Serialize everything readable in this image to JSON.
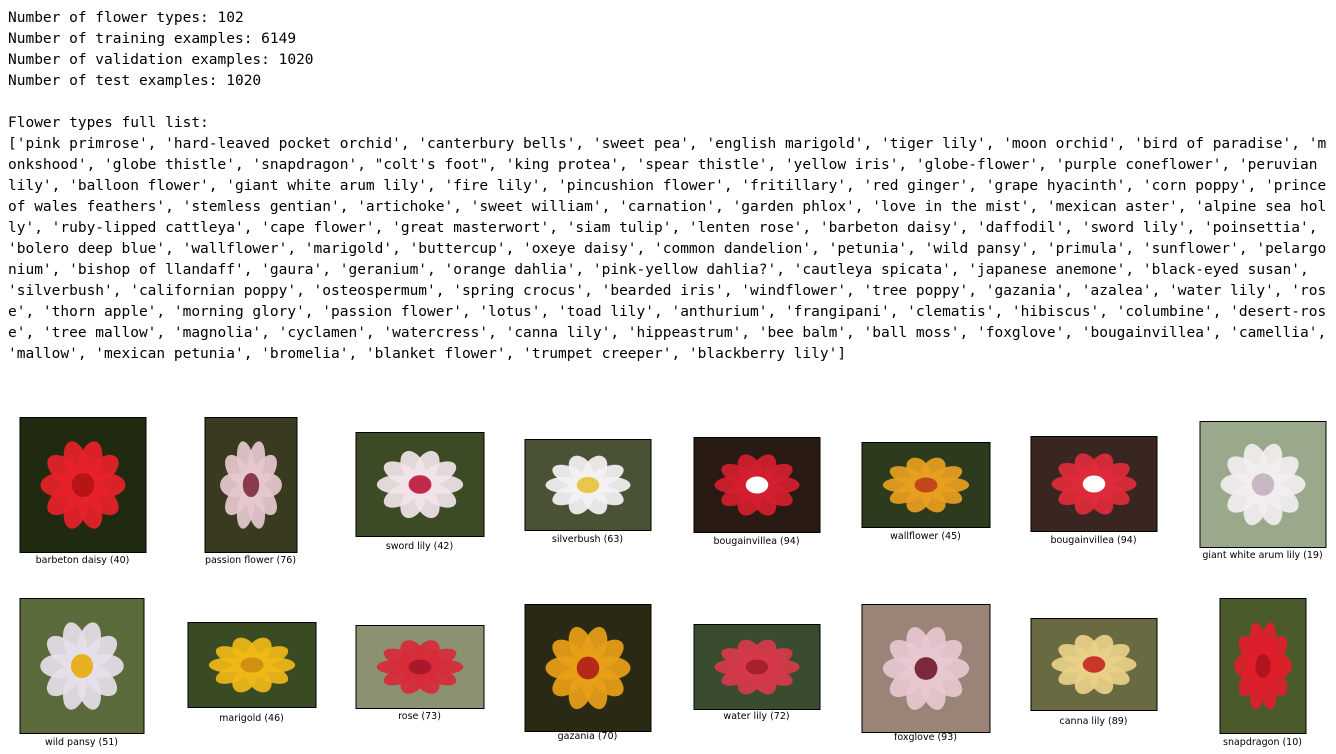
{
  "output": {
    "stats": [
      "Number of flower types: 102",
      "Number of training examples: 6149",
      "Number of validation examples: 1020",
      "Number of test examples: 1020"
    ],
    "list_heading": "Flower types full list:",
    "list_text": "['pink primrose', 'hard-leaved pocket orchid', 'canterbury bells', 'sweet pea', 'english marigold', 'tiger lily', 'moon orchid', 'bird of paradise', 'monkshood', 'globe thistle', 'snapdragon', \"colt's foot\", 'king protea', 'spear thistle', 'yellow iris', 'globe-flower', 'purple coneflower', 'peruvian lily', 'balloon flower', 'giant white arum lily', 'fire lily', 'pincushion flower', 'fritillary', 'red ginger', 'grape hyacinth', 'corn poppy', 'prince of wales feathers', 'stemless gentian', 'artichoke', 'sweet william', 'carnation', 'garden phlox', 'love in the mist', 'mexican aster', 'alpine sea holly', 'ruby-lipped cattleya', 'cape flower', 'great masterwort', 'siam tulip', 'lenten rose', 'barbeton daisy', 'daffodil', 'sword lily', 'poinsettia', 'bolero deep blue', 'wallflower', 'marigold', 'buttercup', 'oxeye daisy', 'common dandelion', 'petunia', 'wild pansy', 'primula', 'sunflower', 'pelargonium', 'bishop of llandaff', 'gaura', 'geranium', 'orange dahlia', 'pink-yellow dahlia?', 'cautleya spicata', 'japanese anemone', 'black-eyed susan', 'silverbush', 'californian poppy', 'osteospermum', 'spring crocus', 'bearded iris', 'windflower', 'tree poppy', 'gazania', 'azalea', 'water lily', 'rose', 'thorn apple', 'morning glory', 'passion flower', 'lotus', 'toad lily', 'anthurium', 'frangipani', 'clematis', 'hibiscus', 'columbine', 'desert-rose', 'tree mallow', 'magnolia', 'cyclamen', 'watercress', 'canna lily', 'hippeastrum', 'bee balm', 'ball moss', 'foxglove', 'bougainvillea', 'camellia', 'mallow', 'mexican petunia', 'bromelia', 'blanket flower', 'trumpet creeper', 'blackberry lily']"
  },
  "gallery": [
    {
      "caption": "barbeton daisy (40)",
      "icon": "red-daisy-photo",
      "bg": "#1f2a10",
      "petal": "#e8222a",
      "center": "#b81418"
    },
    {
      "caption": "passion flower (76)",
      "icon": "passion-flower-photo",
      "bg": "#3a3a20",
      "petal": "#e6c9cf",
      "center": "#8a3a4a"
    },
    {
      "caption": "sword lily (42)",
      "icon": "sword-lily-photo",
      "bg": "#3c4a26",
      "petal": "#f2e4e8",
      "center": "#c22a4a"
    },
    {
      "caption": "silverbush (63)",
      "icon": "silverbush-photo",
      "bg": "#4a5236",
      "petal": "#f4f2f4",
      "center": "#e8c84a"
    },
    {
      "caption": "bougainvillea (94)",
      "icon": "bougainvillea-photo",
      "bg": "#2a1a14",
      "petal": "#d41e2e",
      "center": "#ffffff"
    },
    {
      "caption": "wallflower (45)",
      "icon": "wallflower-photo",
      "bg": "#2c3a1e",
      "petal": "#e8a020",
      "center": "#c2481a"
    },
    {
      "caption": "bougainvillea (94)",
      "icon": "bougainvillea-photo",
      "bg": "#3a2620",
      "petal": "#e02a3a",
      "center": "#ffffff"
    },
    {
      "caption": "giant white arum lily (19)",
      "icon": "arum-lily-photo",
      "bg": "#9aa88c",
      "petal": "#f2eef0",
      "center": "#c8b8c4"
    },
    {
      "caption": "wild pansy (51)",
      "icon": "wild-pansy-photo",
      "bg": "#5a6a3a",
      "petal": "#e6e0ea",
      "center": "#e8b020"
    },
    {
      "caption": "marigold (46)",
      "icon": "marigold-photo",
      "bg": "#3a4a22",
      "petal": "#f0b818",
      "center": "#d09010"
    },
    {
      "caption": "rose (73)",
      "icon": "rose-photo",
      "bg": "#8a9272",
      "petal": "#d82a3a",
      "center": "#a8182a"
    },
    {
      "caption": "gazania (70)",
      "icon": "gazania-photo",
      "bg": "#2a2a14",
      "petal": "#e8a018",
      "center": "#b42a18"
    },
    {
      "caption": "water lily (72)",
      "icon": "water-lily-photo",
      "bg": "#3a4c30",
      "petal": "#d8384a",
      "center": "#a8202e"
    },
    {
      "caption": "foxglove (93)",
      "icon": "foxglove-photo",
      "bg": "#9a8478",
      "petal": "#e8c8d0",
      "center": "#7a2a3a"
    },
    {
      "caption": "canna lily (89)",
      "icon": "canna-lily-photo",
      "bg": "#6a6a42",
      "petal": "#e8d088",
      "center": "#c8382a"
    },
    {
      "caption": "snapdragon (10)",
      "icon": "snapdragon-photo",
      "bg": "#4a5a2a",
      "petal": "#e01e2a",
      "center": "#b01420"
    }
  ]
}
